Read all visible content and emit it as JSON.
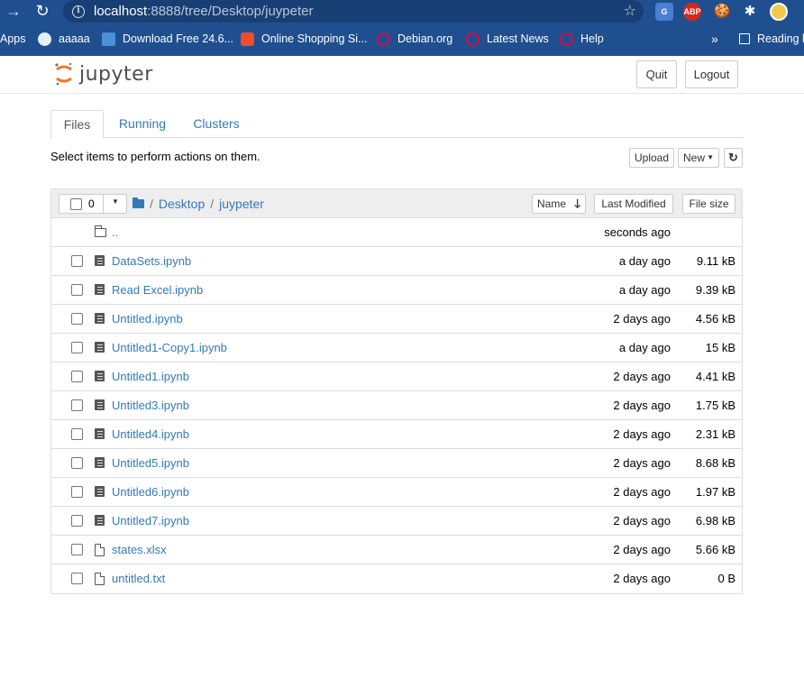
{
  "browser": {
    "url_host": "localhost",
    "url_rest": ":8888/tree/Desktop/juypeter",
    "bookmarks": [
      "Apps",
      "aaaaa",
      "Download Free 24.6...",
      "Online Shopping Si...",
      "Debian.org",
      "Latest News",
      "Help"
    ],
    "overflow": "»",
    "reading_list": "Reading l",
    "ext_abp": "ABP"
  },
  "header": {
    "logo_text": "jupyter",
    "quit_label": "Quit",
    "logout_label": "Logout"
  },
  "tabs": [
    "Files",
    "Running",
    "Clusters"
  ],
  "toolbar": {
    "instruction": "Select items to perform actions on them.",
    "upload_label": "Upload",
    "new_label": "New",
    "refresh_icon": "refresh-icon"
  },
  "list": {
    "selected_count": "0",
    "breadcrumb": [
      "Desktop",
      "juypeter"
    ],
    "sort_name_label": "Name",
    "last_modified_label": "Last Modified",
    "file_size_label": "File size",
    "parent": {
      "name": "..",
      "modified": "seconds ago"
    },
    "items": [
      {
        "name": "DataSets.ipynb",
        "kind": "notebook",
        "modified": "a day ago",
        "size": "9.11 kB"
      },
      {
        "name": "Read Excel.ipynb",
        "kind": "notebook",
        "modified": "a day ago",
        "size": "9.39 kB"
      },
      {
        "name": "Untitled.ipynb",
        "kind": "notebook",
        "modified": "2 days ago",
        "size": "4.56 kB"
      },
      {
        "name": "Untitled1-Copy1.ipynb",
        "kind": "notebook",
        "modified": "a day ago",
        "size": "15 kB"
      },
      {
        "name": "Untitled1.ipynb",
        "kind": "notebook",
        "modified": "2 days ago",
        "size": "4.41 kB"
      },
      {
        "name": "Untitled3.ipynb",
        "kind": "notebook",
        "modified": "2 days ago",
        "size": "1.75 kB"
      },
      {
        "name": "Untitled4.ipynb",
        "kind": "notebook",
        "modified": "2 days ago",
        "size": "2.31 kB"
      },
      {
        "name": "Untitled5.ipynb",
        "kind": "notebook",
        "modified": "2 days ago",
        "size": "8.68 kB"
      },
      {
        "name": "Untitled6.ipynb",
        "kind": "notebook",
        "modified": "2 days ago",
        "size": "1.97 kB"
      },
      {
        "name": "Untitled7.ipynb",
        "kind": "notebook",
        "modified": "2 days ago",
        "size": "6.98 kB"
      },
      {
        "name": "states.xlsx",
        "kind": "file",
        "modified": "2 days ago",
        "size": "5.66 kB"
      },
      {
        "name": "untitled.txt",
        "kind": "file",
        "modified": "2 days ago",
        "size": "0 B"
      }
    ]
  }
}
